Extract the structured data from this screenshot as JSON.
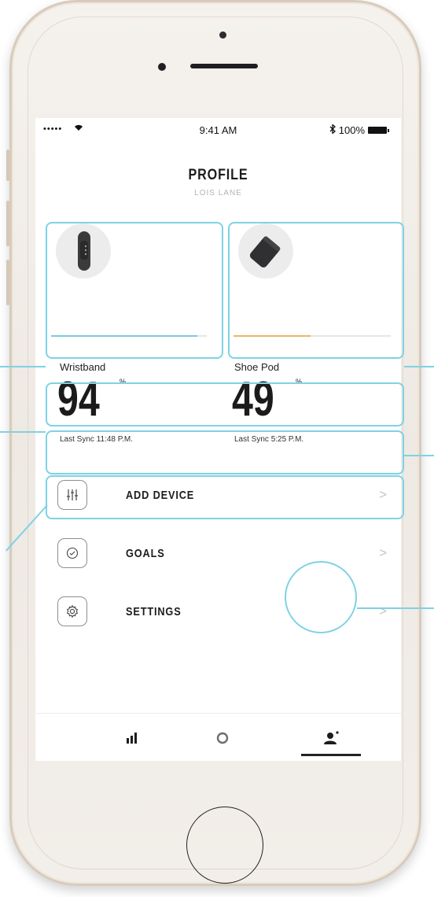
{
  "status_bar": {
    "signal": "•••••",
    "time": "9:41 AM",
    "battery": "100%"
  },
  "header": {
    "title": "PROFILE",
    "subtitle": "LOIS LANE"
  },
  "devices": [
    {
      "name": "Wristband",
      "value": "94",
      "unit": "%",
      "last_sync": "Last Sync 11:48 P.M.",
      "level": 0.94,
      "bar_color": "#7cc9e0"
    },
    {
      "name": "Shoe Pod",
      "value": "49",
      "unit": "%",
      "last_sync": "Last Sync 5:25 P.M.",
      "level": 0.49,
      "bar_color": "#e8b962"
    }
  ],
  "menu": [
    {
      "label": "ADD DEVICE",
      "icon": "sliders-icon"
    },
    {
      "label": "GOALS",
      "icon": "check-circle-icon"
    },
    {
      "label": "SETTINGS",
      "icon": "gear-icon"
    }
  ],
  "tabs": [
    {
      "icon": "bar-chart-icon",
      "active": false
    },
    {
      "icon": "ring-icon",
      "active": false
    },
    {
      "icon": "profile-icon",
      "active": true
    }
  ],
  "colors": {
    "callout": "#7fd2e4",
    "text": "#1c1c1c"
  }
}
